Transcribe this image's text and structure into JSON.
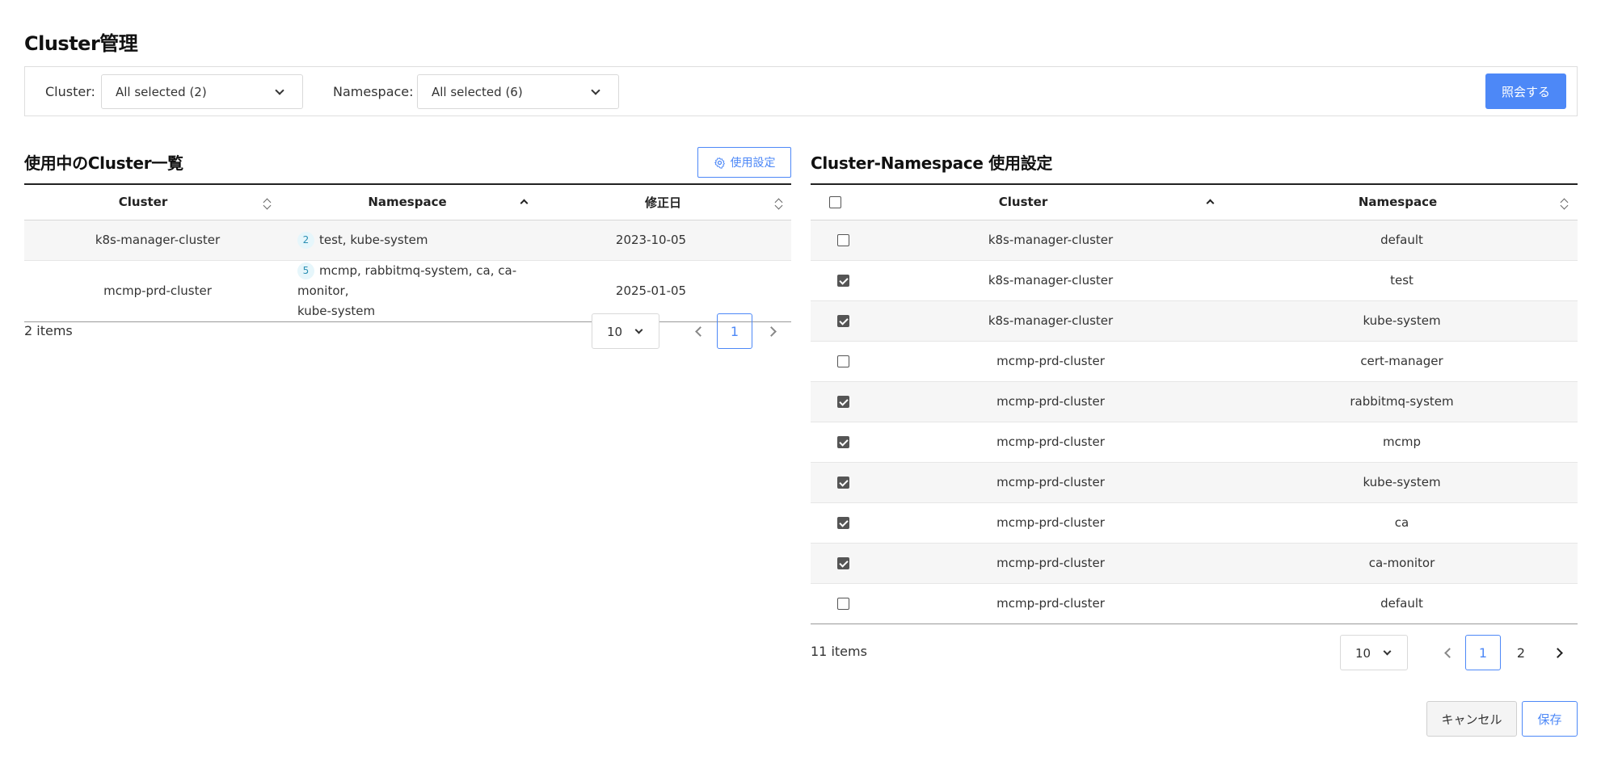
{
  "page": {
    "title": "Cluster管理"
  },
  "filter": {
    "cluster_label": "Cluster:",
    "cluster_value": "All selected (2)",
    "namespace_label": "Namespace:",
    "namespace_value": "All selected (6)",
    "query_button": "照会する"
  },
  "left": {
    "title": "使用中のCluster一覧",
    "settings_button": "使用設定",
    "columns": [
      "Cluster",
      "Namespace",
      "修正日"
    ],
    "rows": [
      {
        "cluster": "k8s-manager-cluster",
        "count": "2",
        "namespaces": "test, kube-system",
        "modified": "2023-10-05"
      },
      {
        "cluster": "mcmp-prd-cluster",
        "count": "5",
        "namespaces": "mcmp, rabbitmq-system, ca, ca-monitor,",
        "namespaces_2": "kube-system",
        "modified": "2025-01-05"
      }
    ],
    "items": "2 items",
    "page_size": "10",
    "pages": [
      "1"
    ]
  },
  "right": {
    "title": "Cluster-Namespace 使用設定",
    "columns": [
      "Cluster",
      "Namespace"
    ],
    "rows": [
      {
        "cluster": "k8s-manager-cluster",
        "namespace": "default",
        "checked": false
      },
      {
        "cluster": "k8s-manager-cluster",
        "namespace": "test",
        "checked": true
      },
      {
        "cluster": "k8s-manager-cluster",
        "namespace": "kube-system",
        "checked": true
      },
      {
        "cluster": "mcmp-prd-cluster",
        "namespace": "cert-manager",
        "checked": false
      },
      {
        "cluster": "mcmp-prd-cluster",
        "namespace": "rabbitmq-system",
        "checked": true
      },
      {
        "cluster": "mcmp-prd-cluster",
        "namespace": "mcmp",
        "checked": true
      },
      {
        "cluster": "mcmp-prd-cluster",
        "namespace": "kube-system",
        "checked": true
      },
      {
        "cluster": "mcmp-prd-cluster",
        "namespace": "ca",
        "checked": true
      },
      {
        "cluster": "mcmp-prd-cluster",
        "namespace": "ca-monitor",
        "checked": true
      },
      {
        "cluster": "mcmp-prd-cluster",
        "namespace": "default",
        "checked": false
      }
    ],
    "items": "11 items",
    "page_size": "10",
    "pages": [
      "1",
      "2"
    ]
  },
  "footer": {
    "cancel_button": "キャンセル",
    "save_button": "保存"
  },
  "colors": {
    "accent": "#4d88f7",
    "badge_bg": "#e6f6fb",
    "badge_text": "#2a8fb3"
  },
  "icons": [
    "chevron-down-icon",
    "gear-icon",
    "sort-icon",
    "sort-asc-icon",
    "chevron-left-icon",
    "chevron-right-icon",
    "checkbox-icon"
  ]
}
